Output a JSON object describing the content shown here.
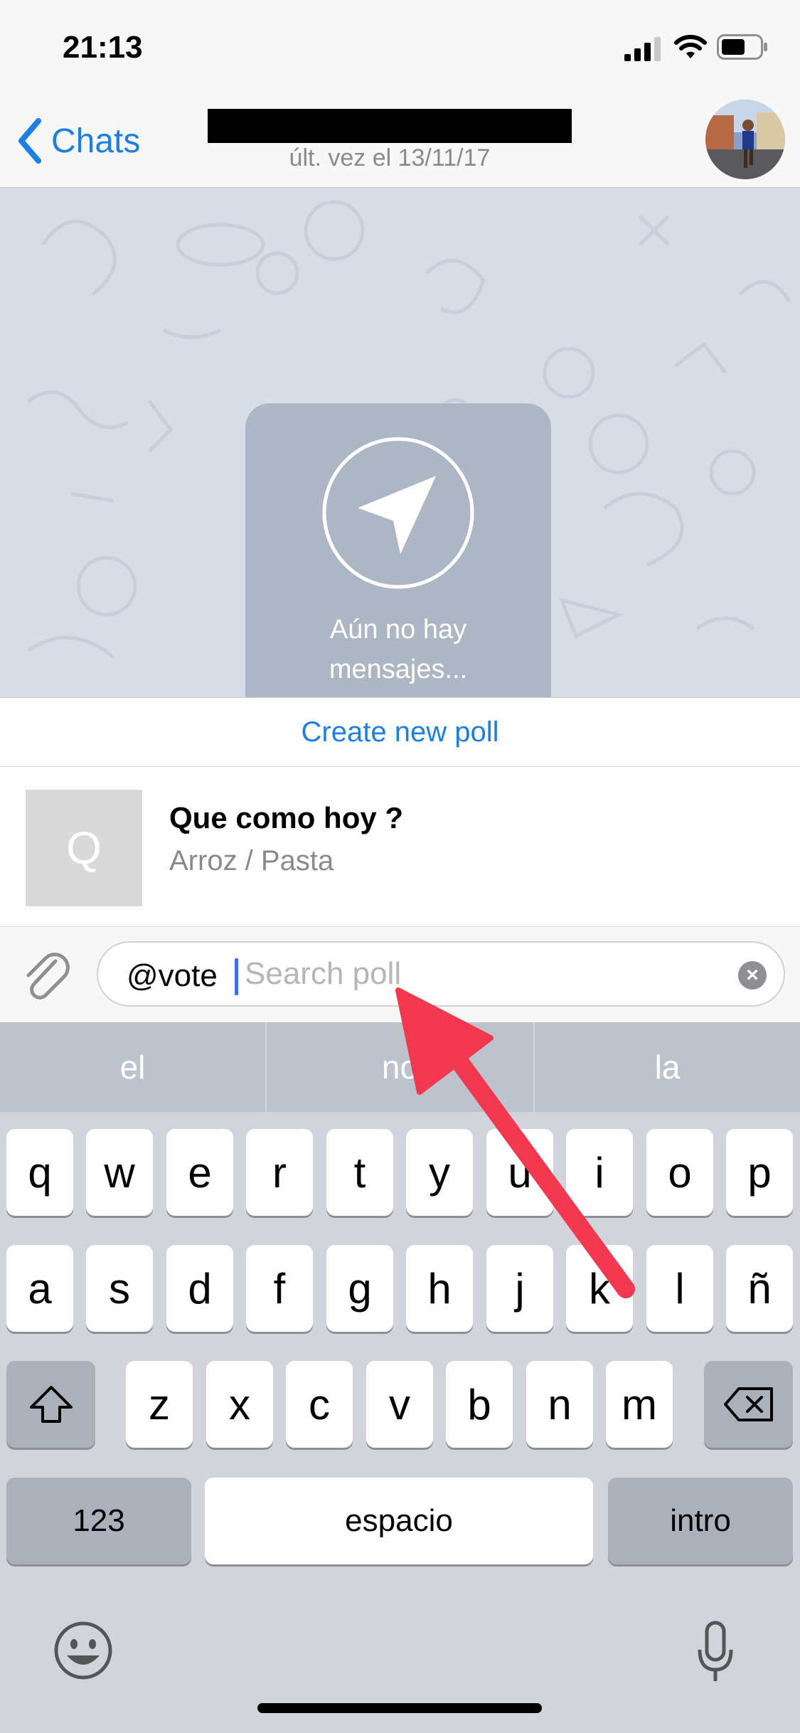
{
  "status_bar": {
    "time": "21:13"
  },
  "nav": {
    "back_label": "Chats",
    "subtitle": "últ. vez el 13/11/17"
  },
  "chat": {
    "empty_line1": "Aún no hay",
    "empty_line2": "mensajes..."
  },
  "results": {
    "create_label": "Create new poll",
    "items": [
      {
        "thumb_letter": "Q",
        "title": "Que como hoy ?",
        "subtitle": "Arroz / Pasta"
      }
    ]
  },
  "input": {
    "prefix": "@vote",
    "placeholder": "Search poll"
  },
  "keyboard": {
    "suggestions": [
      "el",
      "no",
      "la"
    ],
    "row1": [
      "q",
      "w",
      "e",
      "r",
      "t",
      "y",
      "u",
      "i",
      "o",
      "p"
    ],
    "row2": [
      "a",
      "s",
      "d",
      "f",
      "g",
      "h",
      "j",
      "k",
      "l",
      "ñ"
    ],
    "row3": [
      "z",
      "x",
      "c",
      "v",
      "b",
      "n",
      "m"
    ],
    "numbers_label": "123",
    "space_label": "espacio",
    "return_label": "intro"
  },
  "colors": {
    "accent": "#1d7fe3",
    "arrow": "#f2384e",
    "chat_bg": "#d6dde7"
  }
}
